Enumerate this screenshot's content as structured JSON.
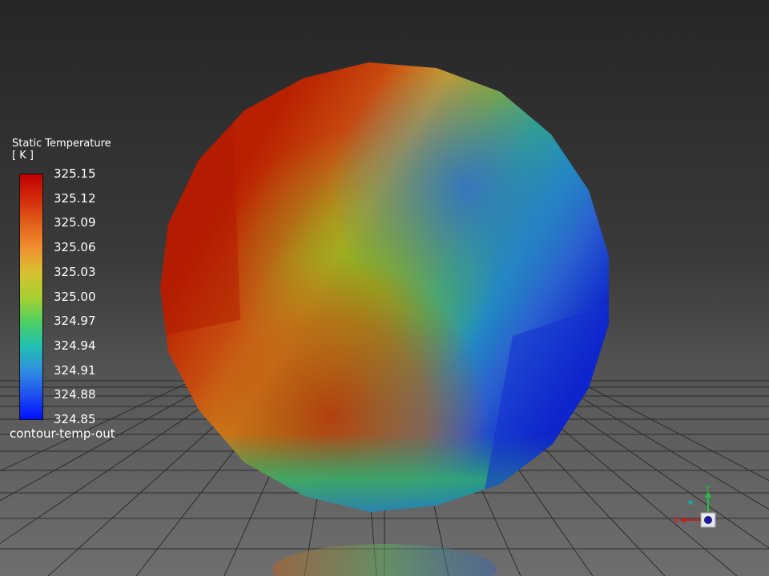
{
  "legend": {
    "title": "Static Temperature",
    "units": "[ K ]",
    "ticks": [
      "325.15",
      "325.12",
      "325.09",
      "325.06",
      "325.03",
      "325.00",
      "324.97",
      "324.94",
      "324.91",
      "324.88",
      "324.85"
    ],
    "name": "contour-temp-out"
  },
  "axes_triad": {
    "x_label": "X",
    "y_label": "Y"
  },
  "colors": {
    "colormap_high": "#c00000",
    "colormap_mid": "#a8d030",
    "colormap_low": "#0010ff"
  }
}
